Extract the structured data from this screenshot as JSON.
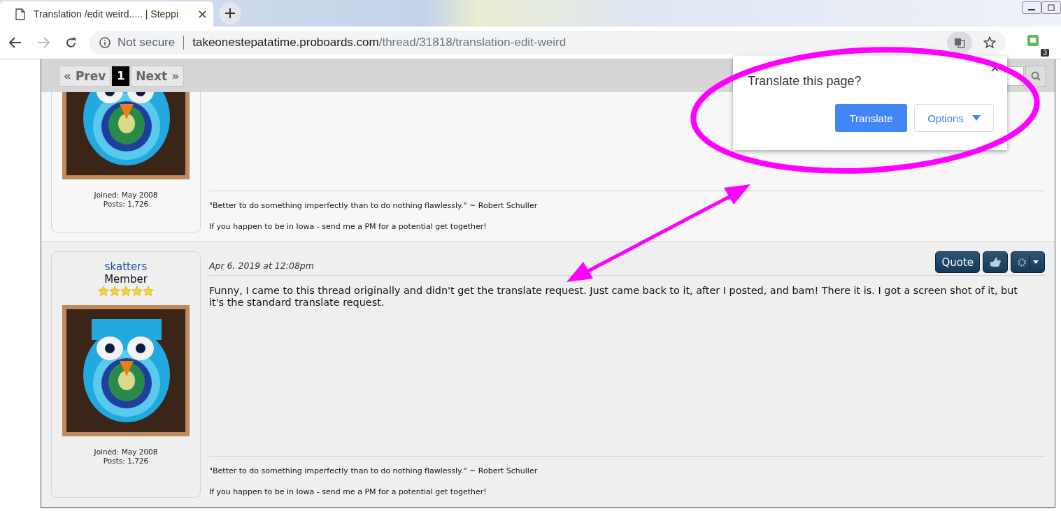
{
  "browser": {
    "tab": {
      "title": "Translation /edit weird..... | Steppi"
    },
    "address": {
      "security": "Not secure",
      "domain": "takeonestepatatime.proboards.com",
      "path": "/thread/31818/translation-edit-weird"
    },
    "extension_badge": "3"
  },
  "pagination": {
    "prev": "« Prev",
    "pages": [
      {
        "label": "1",
        "selected": true
      }
    ],
    "next": "Next »"
  },
  "posts": [
    {
      "avatar_cropped": true,
      "joined": "Joined: May 2008",
      "posts": "Posts: 1,726",
      "signature": [
        "\"Better to do something imperfectly than to do nothing flawlessly.\" ~ Robert Schuller",
        "If you happen to be in Iowa - send me a PM for a potential get together!"
      ]
    },
    {
      "avatar_cropped": false,
      "author": "skatters",
      "rank": "Member",
      "stars": 5,
      "joined": "Joined: May 2008",
      "posts": "Posts: 1,726",
      "date": "Apr 6, 2019 at 12:08pm",
      "quote_button": "Quote",
      "body": "Funny, I came to this thread originally and didn't get the translate request. Just came back to it, after I posted, and bam! There it is. I got a screen shot of it, but it's the standard translate request.",
      "signature": [
        "\"Better to do something imperfectly than to do nothing flawlessly.\" ~ Robert Schuller",
        "If you happen to be in Iowa - send me a PM for a potential get together!"
      ]
    }
  ],
  "translate_popup": {
    "title": "Translate this page?",
    "translate_button": "Translate",
    "options_button": "Options"
  }
}
